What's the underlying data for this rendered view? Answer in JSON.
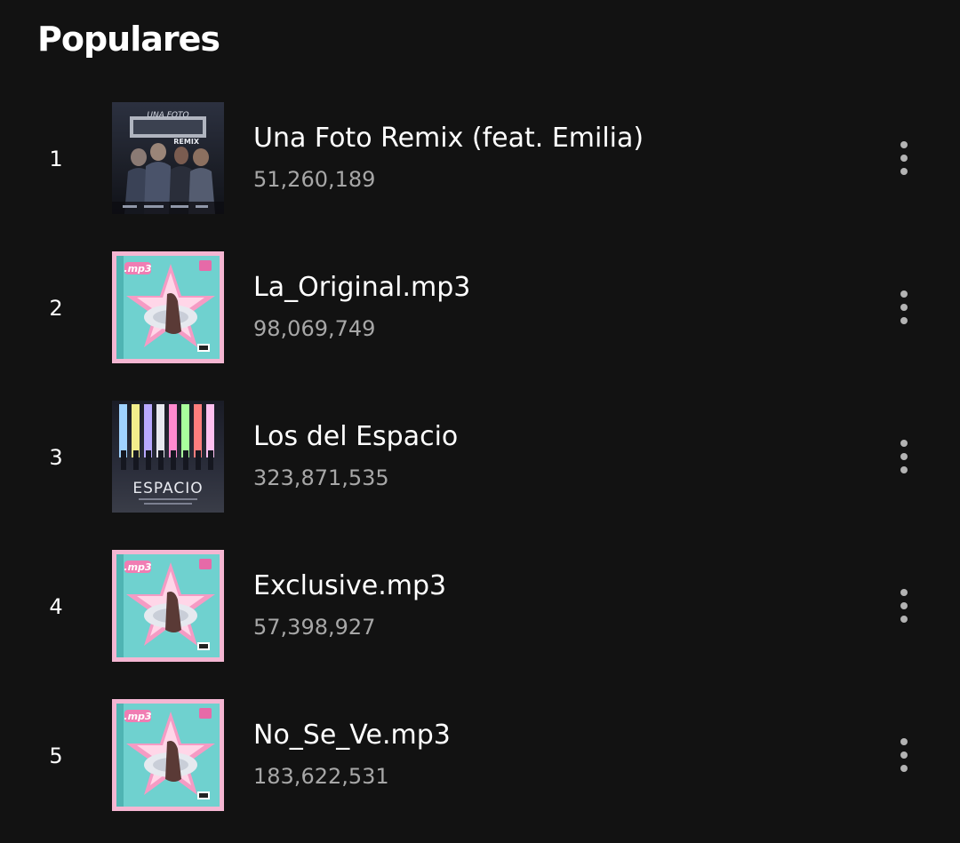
{
  "section": {
    "title": "Populares"
  },
  "tracks": [
    {
      "rank": "1",
      "title": "Una Foto Remix (feat. Emilia)",
      "plays": "51,260,189",
      "cover": "una-foto-remix"
    },
    {
      "rank": "2",
      "title": "La_Original.mp3",
      "plays": "98,069,749",
      "cover": "mp3-album"
    },
    {
      "rank": "3",
      "title": "Los del Espacio",
      "plays": "323,871,535",
      "cover": "los-del-espacio"
    },
    {
      "rank": "4",
      "title": "Exclusive.mp3",
      "plays": "57,398,927",
      "cover": "mp3-album"
    },
    {
      "rank": "5",
      "title": "No_Se_Ve.mp3",
      "plays": "183,622,531",
      "cover": "mp3-album"
    }
  ],
  "cover_art": {
    "una-foto-remix": {
      "title_text": "UNA FOTO",
      "subtitle_text": "REMIX"
    },
    "mp3-album": {
      "title_text": ".mp3"
    },
    "los-del-espacio": {
      "title_text": "ESPACIO"
    }
  },
  "colors": {
    "background": "#121212",
    "text_primary": "#ffffff",
    "text_secondary": "#a7a7a7"
  }
}
